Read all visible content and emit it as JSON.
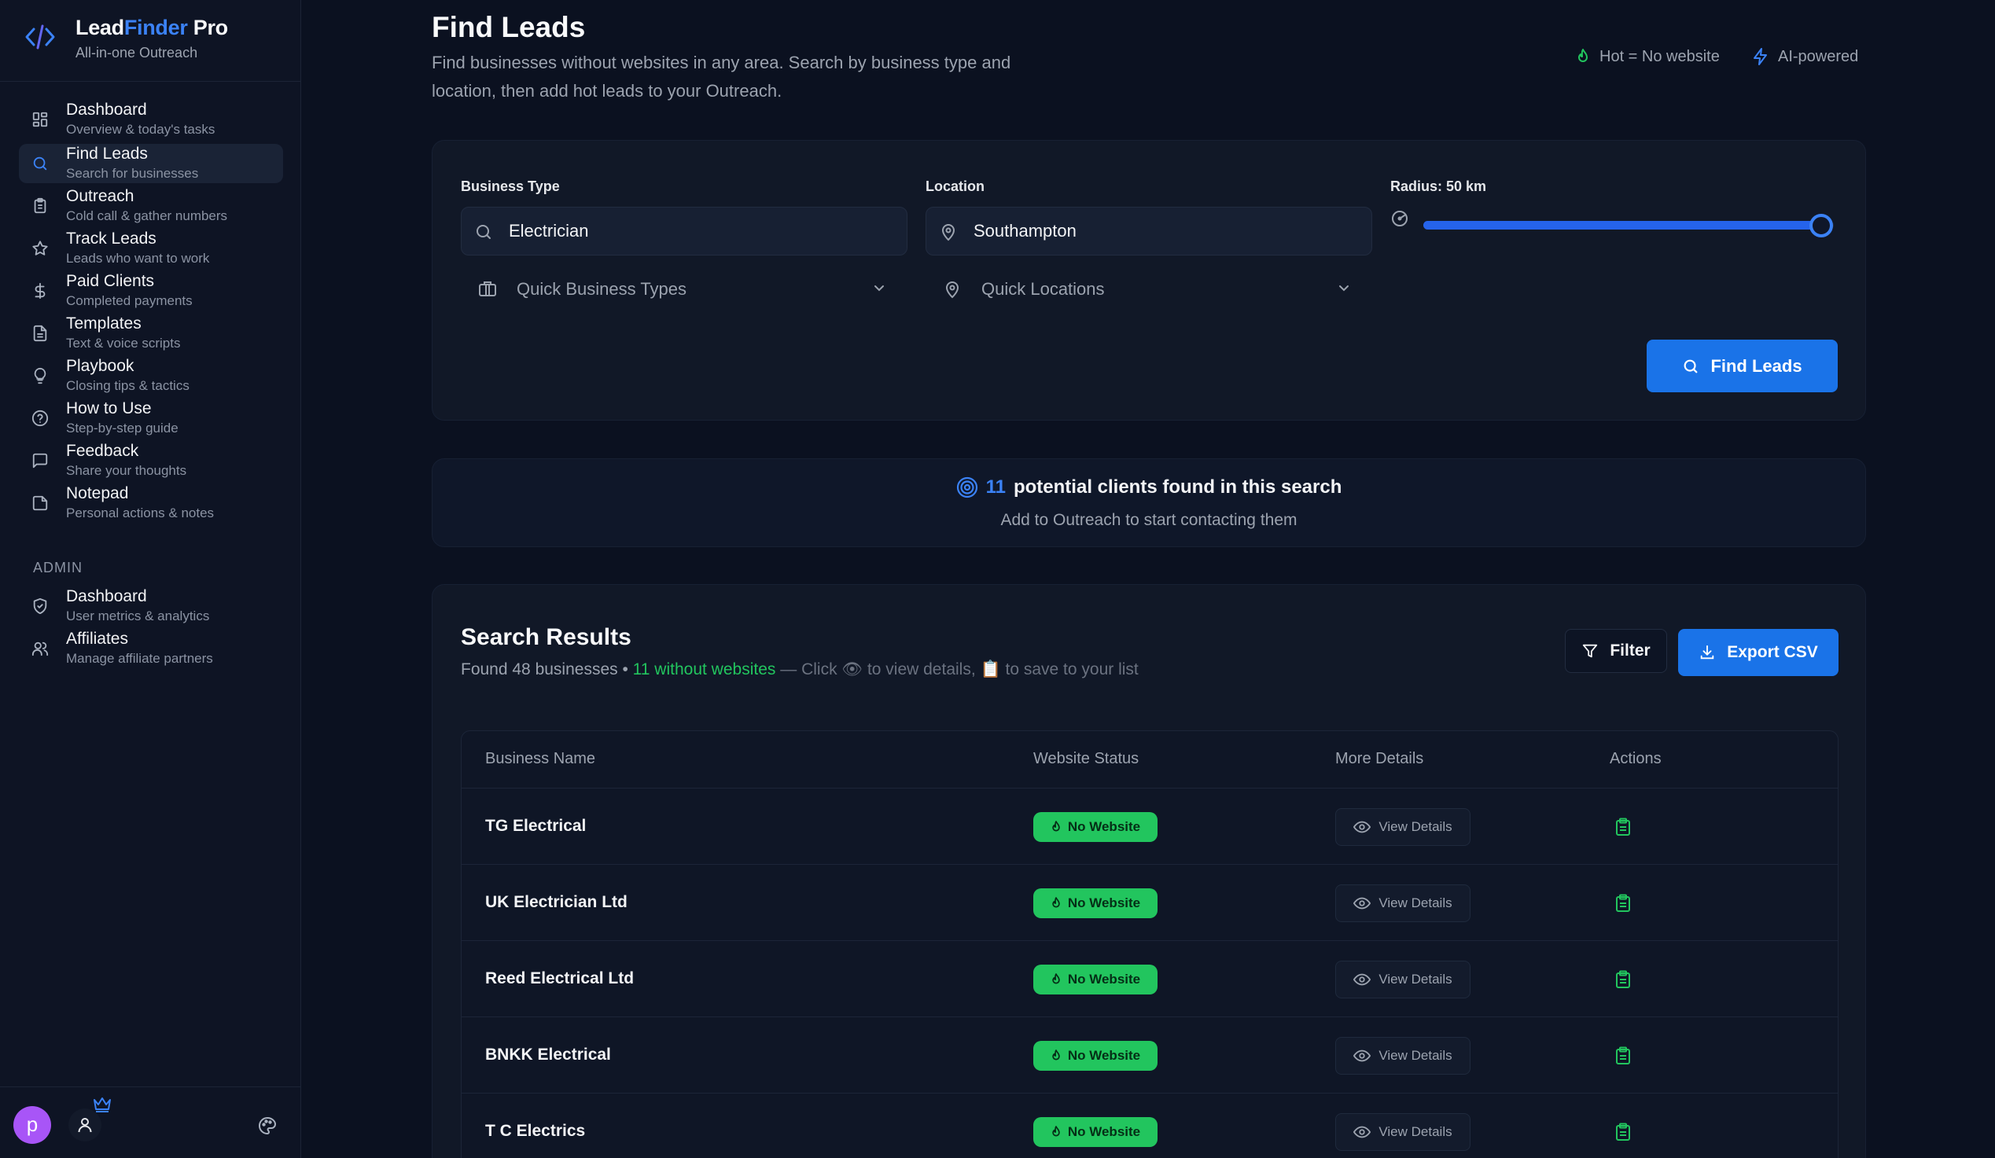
{
  "brand": {
    "name_part1": "Lead",
    "name_part2": "Finder",
    "name_part3": " Pro",
    "tagline": "All-in-one Outreach",
    "accent": "#3b82f6"
  },
  "sidebar": {
    "items": [
      {
        "label": "Dashboard",
        "sub": "Overview & today's tasks",
        "icon": "grid-icon"
      },
      {
        "label": "Find Leads",
        "sub": "Search for businesses",
        "icon": "search-icon",
        "active": true
      },
      {
        "label": "Outreach",
        "sub": "Cold call & gather numbers",
        "icon": "clipboard-icon"
      },
      {
        "label": "Track Leads",
        "sub": "Leads who want to work",
        "icon": "star-icon"
      },
      {
        "label": "Paid Clients",
        "sub": "Completed payments",
        "icon": "dollar-icon"
      },
      {
        "label": "Templates",
        "sub": "Text & voice scripts",
        "icon": "document-icon"
      },
      {
        "label": "Playbook",
        "sub": "Closing tips & tactics",
        "icon": "lightbulb-icon"
      },
      {
        "label": "How to Use",
        "sub": "Step-by-step guide",
        "icon": "help-circle-icon"
      },
      {
        "label": "Feedback",
        "sub": "Share your thoughts",
        "icon": "message-icon"
      },
      {
        "label": "Notepad",
        "sub": "Personal actions & notes",
        "icon": "note-icon"
      }
    ],
    "admin_heading": "ADMIN",
    "admin_items": [
      {
        "label": "Dashboard",
        "sub": "User metrics & analytics",
        "icon": "shield-icon"
      },
      {
        "label": "Affiliates",
        "sub": "Manage affiliate partners",
        "icon": "users-icon"
      }
    ],
    "footer": {
      "avatar_letter": "p"
    }
  },
  "header": {
    "title": "Find Leads",
    "description": "Find businesses without websites in any area. Search by business type and location, then add hot leads to your Outreach.",
    "hot_label": "Hot = No website",
    "ai_label": "AI-powered"
  },
  "search": {
    "business_type_label": "Business Type",
    "business_type_value": "Electrician",
    "location_label": "Location",
    "location_value": "Southampton",
    "radius_label": "Radius: 50 km",
    "radius_fraction": 1.0,
    "quick_business_types": "Quick Business Types",
    "quick_locations": "Quick Locations",
    "find_button": "Find Leads"
  },
  "found": {
    "count": "11",
    "text": "potential clients found in this search",
    "sub": "Add to Outreach to start contacting them"
  },
  "results": {
    "title": "Search Results",
    "summary_prefix": "Found 48 businesses •",
    "summary_green": "11 without websites",
    "summary_hint_1": "— Click",
    "summary_hint_2": "to view details,",
    "summary_hint_3": "to save to your list",
    "filter_button": "Filter",
    "export_button": "Export CSV",
    "columns": [
      "Business Name",
      "Website Status",
      "More Details",
      "Actions"
    ],
    "rows": [
      {
        "name": "TG Electrical",
        "status": "No Website",
        "details": "View Details"
      },
      {
        "name": "UK Electrician Ltd",
        "status": "No Website",
        "details": "View Details"
      },
      {
        "name": "Reed Electrical Ltd",
        "status": "No Website",
        "details": "View Details"
      },
      {
        "name": "BNKK Electrical",
        "status": "No Website",
        "details": "View Details"
      },
      {
        "name": "T C Electrics",
        "status": "No Website",
        "details": "View Details"
      }
    ]
  },
  "colors": {
    "background": "#0b1120",
    "primary": "#1a73e8",
    "hot_green": "#22c55e"
  }
}
